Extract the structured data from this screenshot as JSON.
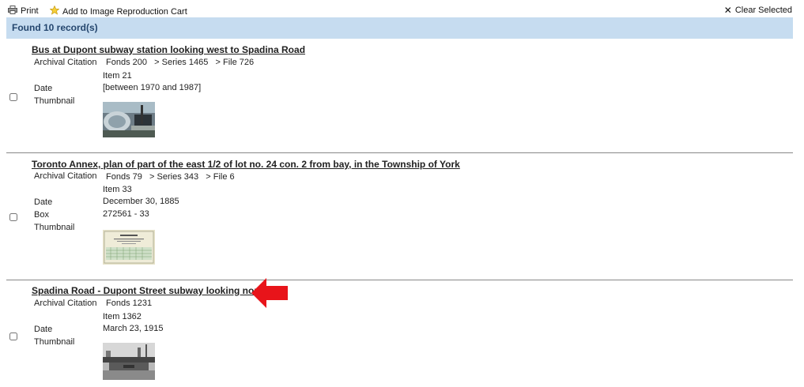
{
  "toolbar": {
    "print_label": "Print",
    "cart_label": "Add to Image Reproduction Cart",
    "clear_label": "Clear Selected",
    "print_icon": "printer-icon",
    "cart_icon": "star-icon",
    "clear_icon": "close-icon"
  },
  "results": {
    "found_label": "Found 10 record(s)"
  },
  "labels": {
    "citation": "Archival Citation",
    "date": "Date",
    "box": "Box",
    "thumbnail": "Thumbnail"
  },
  "records": [
    {
      "title": "Bus at Dupont subway station looking west to Spadina Road",
      "citation": "Fonds 200   > Series 1465   > File 726",
      "item": "Item 21",
      "date": "[between 1970 and 1987]"
    },
    {
      "title": "Toronto Annex, plan of part of the east 1/2 of lot no. 24 con. 2 from bay, in the Township of York",
      "citation": "Fonds 79   > Series 343   > File 6",
      "item": "Item 33",
      "date": "December 30, 1885",
      "box": "272561 - 33"
    },
    {
      "title": "Spadina Road - Dupont Street subway looking north",
      "citation": "Fonds 1231",
      "item": "Item 1362",
      "date": "March 23, 1915"
    }
  ],
  "annotation": {
    "arrow_color": "#e8141a"
  }
}
